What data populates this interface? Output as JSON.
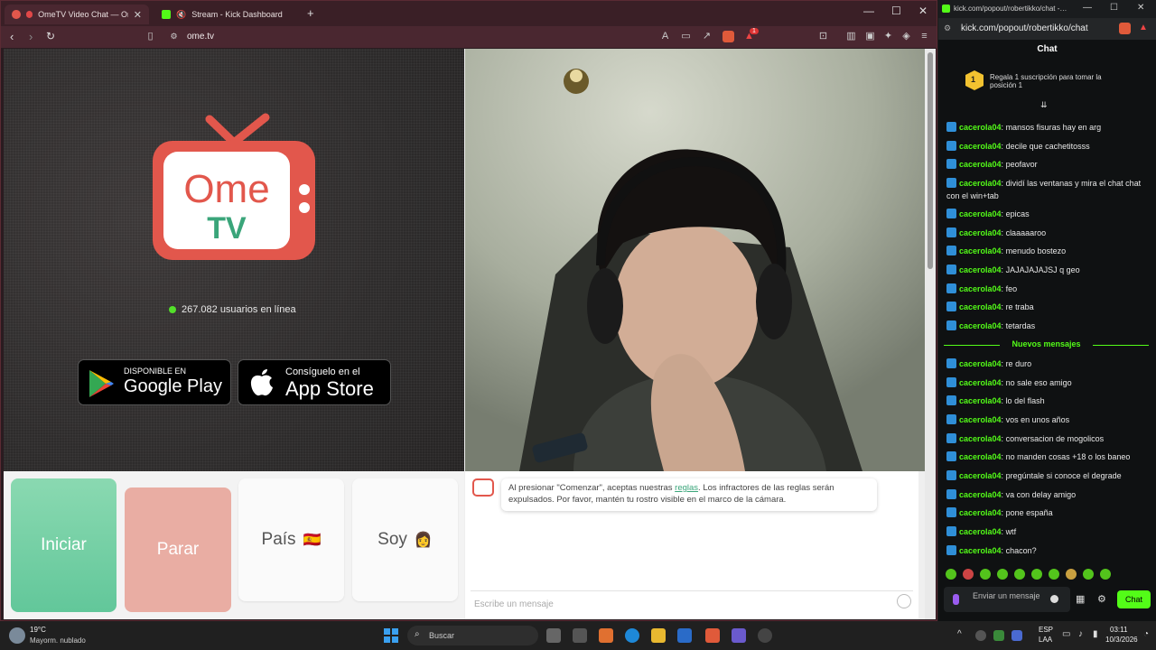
{
  "browser": {
    "tabs": [
      {
        "label": "OmeTV Video Chat — Omeg",
        "close": "✕"
      },
      {
        "label": "Stream - Kick Dashboard"
      }
    ],
    "new_tab": "+",
    "url": "ome.tv",
    "window_controls": [
      "—",
      "☐",
      "✕"
    ],
    "notification_count": "1"
  },
  "ometv": {
    "logo_top": "Ome",
    "logo_bottom": "TV",
    "online_count": "267.082 usuarios en línea",
    "google_play": {
      "small": "DISPONIBLE EN",
      "big": "Google Play"
    },
    "app_store": {
      "small": "Consíguelo en el",
      "big": "App Store"
    },
    "buttons": {
      "start": "Iniciar",
      "stop": "Parar",
      "country": "País",
      "country_flag": "🇪🇸",
      "gender": "Soy",
      "gender_emoji": "👩"
    },
    "notice": {
      "before": "Al presionar \"Comenzar\", aceptas nuestras ",
      "link": "reglas",
      "after": ". Los infractores de las reglas serán expulsados. Por favor, mantén tu rostro visible en el marco de la cámara."
    },
    "message_placeholder": "Escribe un mensaje"
  },
  "kick": {
    "titlebar_url": "kick.com/popout/robertikko/chat -…",
    "url": "kick.com/popout/robertikko/chat",
    "window_controls": [
      "—",
      "☐",
      "✕"
    ],
    "chat_title": "Chat",
    "pinned": {
      "rank": "1",
      "text": "Regala 1 suscripción para tomar la posición 1"
    },
    "messages_old": [
      {
        "user": "cacerola04",
        "text": "mansos fisuras hay en arg"
      },
      {
        "user": "cacerola04",
        "text": "decile que cachetitosss"
      },
      {
        "user": "cacerola04",
        "text": "peofavor"
      },
      {
        "user": "cacerola04",
        "text": "dividí las ventanas y mira el chat chat con el win+tab"
      },
      {
        "user": "cacerola04",
        "text": "epicas"
      },
      {
        "user": "cacerola04",
        "text": "claaaaaroo"
      },
      {
        "user": "cacerola04",
        "text": "menudo bostezo"
      },
      {
        "user": "cacerola04",
        "text": "JAJAJAJAJSJ q geo"
      },
      {
        "user": "cacerola04",
        "text": "feo"
      },
      {
        "user": "cacerola04",
        "text": "re traba"
      },
      {
        "user": "cacerola04",
        "text": "tetardas"
      }
    ],
    "new_messages_label": "Nuevos mensajes",
    "messages_new": [
      {
        "user": "cacerola04",
        "text": "re duro"
      },
      {
        "user": "cacerola04",
        "text": "no sale eso amigo"
      },
      {
        "user": "cacerola04",
        "text": "lo del flash"
      },
      {
        "user": "cacerola04",
        "text": "vos en unos años"
      },
      {
        "user": "cacerola04",
        "text": "conversacion de mogolicos"
      },
      {
        "user": "cacerola04",
        "text": "no manden cosas +18 o los baneo"
      },
      {
        "user": "cacerola04",
        "text": "pregúntale si conoce el degrade"
      },
      {
        "user": "cacerola04",
        "text": "va con delay amigo"
      },
      {
        "user": "cacerola04",
        "text": "pone españa"
      },
      {
        "user": "cacerola04",
        "text": "wtf"
      },
      {
        "user": "cacerola04",
        "text": "chacon?"
      }
    ],
    "input_placeholder": "Enviar un mensaje",
    "send": "Chat"
  },
  "taskbar": {
    "weather_temp": "19°C",
    "weather_desc": "Mayorm. nublado",
    "search": "Buscar",
    "lang_top": "ESP",
    "lang_bottom": "LAA",
    "time": "03:11",
    "date": "10/3/2026"
  }
}
